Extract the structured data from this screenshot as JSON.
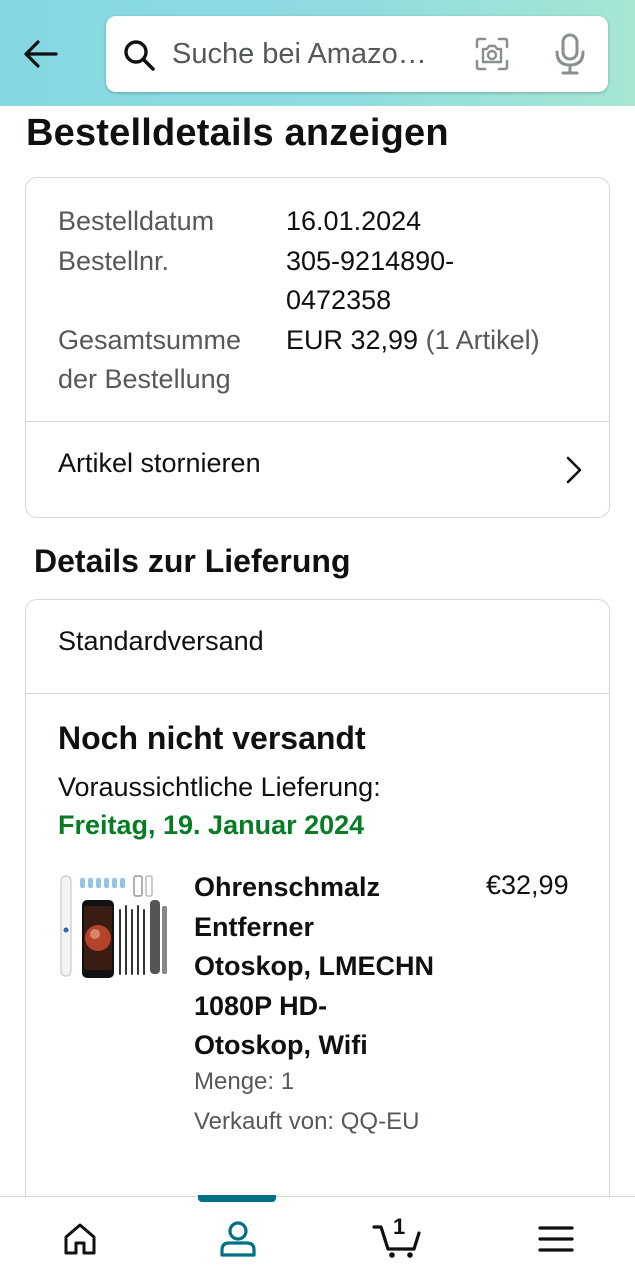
{
  "header": {
    "search_placeholder": "Suche bei Amazo…",
    "icons": [
      "back-arrow-icon",
      "search-icon",
      "camera-icon",
      "microphone-icon"
    ]
  },
  "page": {
    "title": "Bestelldetails anzeigen"
  },
  "order": {
    "date_label": "Bestelldatum",
    "date_value": "16.01.2024",
    "number_label": "Bestellnr.",
    "number_value_line1": "305-9214890-",
    "number_value_line2": "0472358",
    "total_label_line1": "Gesamtsumme",
    "total_label_line2": "der Bestellung",
    "total_value": "EUR 32,99",
    "total_items": "(1 Artikel)",
    "cancel_label": "Artikel stornieren"
  },
  "delivery": {
    "section_title": "Details zur Lieferung",
    "shipping_method": "Standardversand",
    "status": "Noch nicht versandt",
    "eta_label": "Voraussichtliche Lieferung:",
    "eta_date": "Freitag, 19. Januar 2024",
    "status_color": "#067d25",
    "product": {
      "title_lines": [
        "Ohrenschmalz",
        "Entferner",
        "Otoskop, LMECHN",
        "1080P HD-",
        "Otoskop, Wifi"
      ],
      "price": "€32,99",
      "quantity": "Menge: 1",
      "seller": "Verkauft von: QQ-EU"
    }
  },
  "bottom_nav": {
    "items": [
      "home-icon",
      "account-icon",
      "cart-icon",
      "menu-icon"
    ],
    "active": "account-icon",
    "cart_count": "1",
    "accent_color": "#007185"
  }
}
